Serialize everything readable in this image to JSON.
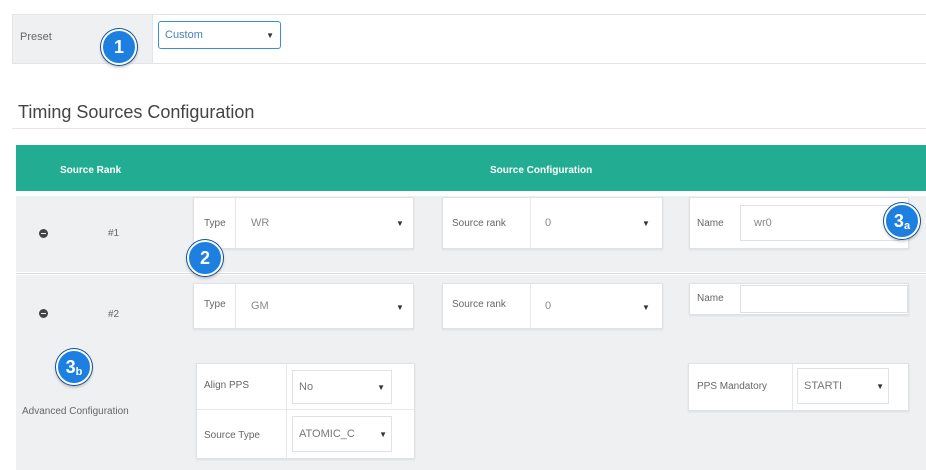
{
  "preset": {
    "label": "Preset",
    "value": "Custom"
  },
  "section_title": "Timing Sources Configuration",
  "table": {
    "headers": {
      "source_rank": "Source Rank",
      "source_configuration": "Source Configuration"
    },
    "rows": [
      {
        "rank": "#1",
        "type_label": "Type",
        "type_value": "WR",
        "source_rank_label": "Source rank",
        "source_rank_value": "0",
        "name_label": "Name",
        "name_value": "wr0"
      },
      {
        "rank": "#2",
        "type_label": "Type",
        "type_value": "GM",
        "source_rank_label": "Source rank",
        "source_rank_value": "0",
        "name_label": "Name",
        "name_value": ""
      }
    ],
    "advanced": {
      "label": "Advanced Configuration",
      "align_pps_label": "Align PPS",
      "align_pps_value": "No",
      "source_type_label": "Source Type",
      "source_type_value": "ATOMIC_C",
      "pps_mandatory_label": "PPS Mandatory",
      "pps_mandatory_value": "STARTI"
    }
  },
  "callouts": {
    "c1": "1",
    "c2": "2",
    "c3a": "3",
    "c3a_sub": "a",
    "c3b": "3",
    "c3b_sub": "b"
  },
  "icons": {
    "caret": "▼",
    "remove": "remove-circle-icon"
  },
  "colors": {
    "header": "#22ad92",
    "callout": "#1d7fe0",
    "focus_border": "#3a8fd9"
  }
}
